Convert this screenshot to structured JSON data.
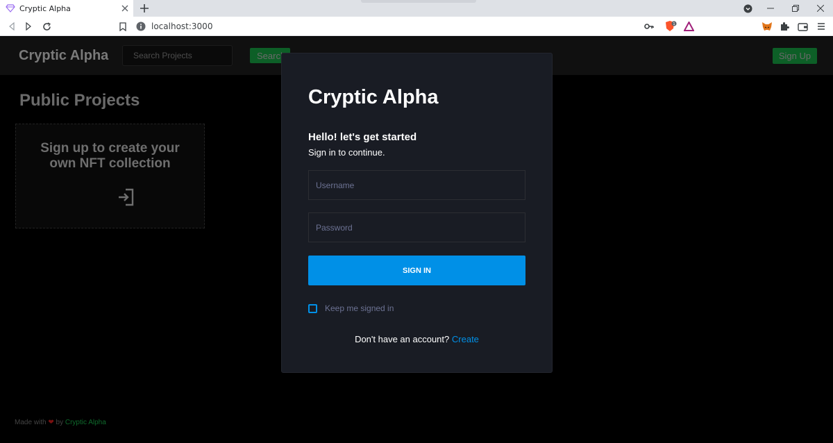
{
  "browser": {
    "tab_title": "Cryptic Alpha",
    "url": "localhost:3000",
    "brave_badge": "1"
  },
  "navbar": {
    "brand": "Cryptic Alpha",
    "search_placeholder": "Search Projects",
    "search_label": "Search",
    "signup_label": "Sign Up"
  },
  "main": {
    "heading": "Public Projects",
    "cta_text": "Sign up to create your own NFT collection"
  },
  "modal": {
    "title": "Cryptic Alpha",
    "greeting": "Hello! let's get started",
    "subtitle": "Sign in to continue.",
    "username_placeholder": "Username",
    "password_placeholder": "Password",
    "signin_label": "SIGN IN",
    "keep_signed_in": "Keep me signed in",
    "no_account": "Don't have an account?",
    "create_link": "Create"
  },
  "footer": {
    "made_with": "Made with",
    "heart": "❤",
    "by": "by",
    "link": "Cryptic Alpha"
  },
  "colors": {
    "accent_blue": "#0090e7",
    "green": "#0d5f27",
    "modal_bg": "#191c24"
  }
}
